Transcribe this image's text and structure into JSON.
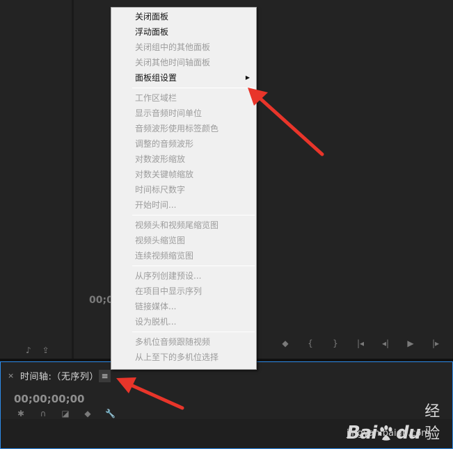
{
  "program_monitor": {
    "timecode": "00;0"
  },
  "source_controls": [
    "♪",
    "⇪"
  ],
  "program_controls": [
    "◆",
    "{",
    "}",
    "|◂",
    "◂|",
    "▶",
    "|▸",
    "▸"
  ],
  "timeline": {
    "close": "×",
    "title": "时间轴:（无序列）",
    "menu_icon": "≡",
    "timecode": "00;00;00;00",
    "tools": [
      "✱",
      "∩",
      "◪",
      "◆",
      "🔧"
    ]
  },
  "menu": {
    "items": [
      {
        "label": "关闭面板",
        "enabled": true
      },
      {
        "label": "浮动面板",
        "enabled": true
      },
      {
        "label": "关闭组中的其他面板",
        "enabled": false
      },
      {
        "label": "关闭其他时间轴面板",
        "enabled": false
      },
      {
        "label": "面板组设置",
        "enabled": true,
        "submenu": "▶"
      },
      {
        "label": "工作区域栏",
        "enabled": false
      },
      {
        "label": "显示音频时间单位",
        "enabled": false
      },
      {
        "label": "音频波形使用标签颜色",
        "enabled": false
      },
      {
        "label": "调整的音频波形",
        "enabled": false
      },
      {
        "label": "对数波形缩放",
        "enabled": false
      },
      {
        "label": "对数关键帧缩放",
        "enabled": false
      },
      {
        "label": "时间标尺数字",
        "enabled": false
      },
      {
        "label": "开始时间...",
        "enabled": false
      },
      {
        "label": "视频头和视频尾缩览图",
        "enabled": false
      },
      {
        "label": "视频头缩览图",
        "enabled": false
      },
      {
        "label": "连续视频缩览图",
        "enabled": false
      },
      {
        "label": "从序列创建预设...",
        "enabled": false
      },
      {
        "label": "在项目中显示序列",
        "enabled": false
      },
      {
        "label": "链接媒体...",
        "enabled": false
      },
      {
        "label": "设为脱机...",
        "enabled": false
      },
      {
        "label": "多机位音频跟随视频",
        "enabled": false
      },
      {
        "label": "从上至下的多机位选择",
        "enabled": false
      }
    ]
  },
  "watermark": {
    "brand_left": "Bai",
    "brand_right": "du",
    "brand_cn": "经验",
    "url": "jingyan.baidu.com"
  },
  "colors": {
    "annotation_arrow": "#e8352a",
    "timeline_border": "#2d8ceb"
  }
}
